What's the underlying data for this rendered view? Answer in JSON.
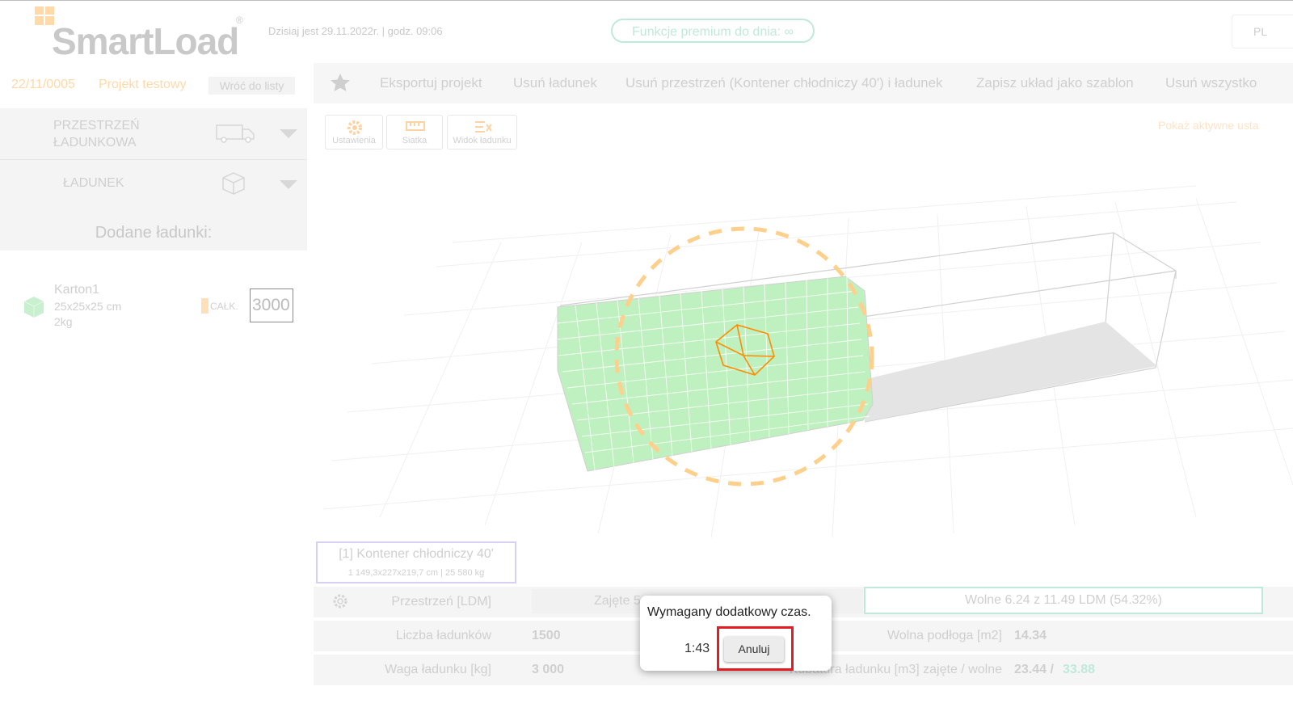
{
  "header": {
    "logo_text": "SmartLoad",
    "logo_mark": "®",
    "date_text": "Dzisiaj jest 29.11.2022r. | godz. 09:06",
    "premium_label": "Funkcje premium do dnia: ∞",
    "language": "PL"
  },
  "project": {
    "id": "22/11/0005",
    "name": "Projekt testowy",
    "back_label": "Wróć do listy"
  },
  "sidebar": {
    "space_section": "PRZESTRZEŃ ŁADUNKOWA",
    "cargo_section": "ŁADUNEK",
    "added_title": "Dodane ładunki:",
    "cargo_item": {
      "name": "Karton1",
      "dims": "25x25x25 cm",
      "weight": "2kg",
      "total_label": "CAŁK.",
      "quantity": "3000"
    }
  },
  "toolbar": {
    "menu": [
      "Eksportuj projekt",
      "Usuń ładunek",
      "Usuń przestrzeń (Kontener chłodniczy 40') i ładunek",
      "Zapisz układ jako szablon",
      "Usuń wszystko"
    ],
    "tools": [
      "Ustawienia",
      "Siatka",
      "Widok ładunku"
    ],
    "show_settings": "Pokaż aktywne usta"
  },
  "viewport": {
    "container_label": "[1] Kontener chłodniczy 40'",
    "container_dims": "1 149,3x227x219,7 cm | 25 580 kg",
    "colors": {
      "cargo_fill": "#bff0bf",
      "highlight_cube": "#ff8c00",
      "rotate_ring": "#ffcf8c"
    }
  },
  "stats": {
    "space_label": "Przestrzeń [LDM]",
    "occupied_label": "Zajęte 5",
    "free_label": "Wolne 6.24 z 11.49 LDM (54.32%)",
    "count_label": "Liczba ładunków",
    "count_value": "1500",
    "free_floor_label": "Wolna podłoga [m2]",
    "free_floor_value": "14.34",
    "weight_label": "Waga ładunku [kg]",
    "weight_value": "3 000",
    "volume_label": "Kubatura ładunku [m3] zajęte / wolne",
    "volume_occupied": "23.44 /",
    "volume_free": "33.88"
  },
  "dialog": {
    "title": "Wymagany dodatkowy czas.",
    "timer": "1:43",
    "cancel_label": "Anuluj"
  }
}
